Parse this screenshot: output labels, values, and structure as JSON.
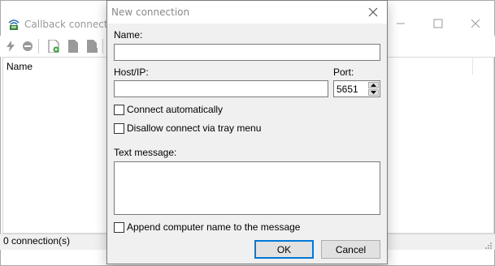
{
  "background_window": {
    "title": "Callback connection",
    "list": {
      "column_name": "Name"
    },
    "status": "0 connection(s)"
  },
  "dialog": {
    "title": "New connection",
    "name_label": "Name:",
    "name_value": "",
    "host_label": "Host/IP:",
    "host_value": "",
    "port_label": "Port:",
    "port_value": "5651",
    "connect_auto_label": "Connect automatically",
    "disallow_tray_label": "Disallow connect via tray menu",
    "text_message_label": "Text message:",
    "text_message_value": "",
    "append_name_label": "Append computer name to the message",
    "ok_label": "OK",
    "cancel_label": "Cancel"
  },
  "colors": {
    "dialog_bg": "#f0f0f0",
    "accent": "#0078d7"
  }
}
